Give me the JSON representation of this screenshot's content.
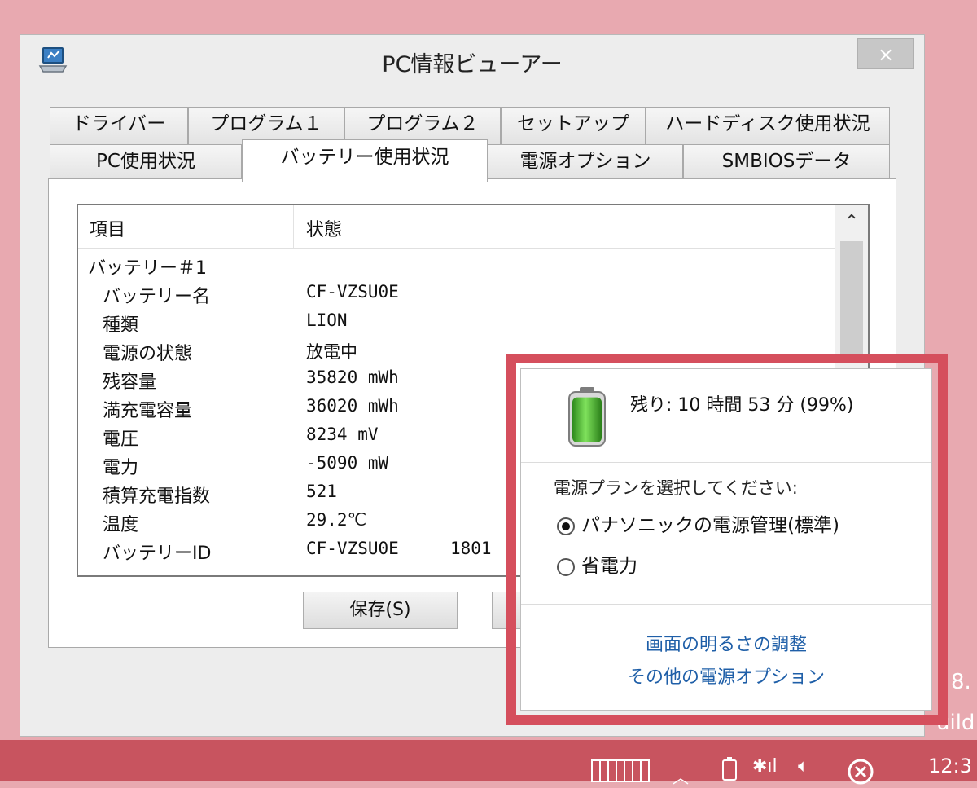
{
  "window": {
    "title": "PC情報ビューアー",
    "close_label": "×"
  },
  "tabs": {
    "row1": [
      {
        "label": "ドライバー"
      },
      {
        "label": "プログラム１"
      },
      {
        "label": "プログラム２"
      },
      {
        "label": "セットアップ"
      },
      {
        "label": "ハードディスク使用状況"
      }
    ],
    "row2": [
      {
        "label": "PC使用状況"
      },
      {
        "label": "バッテリー使用状況",
        "active": true
      },
      {
        "label": "電源オプション"
      },
      {
        "label": "SMBIOSデータ"
      }
    ]
  },
  "list": {
    "columns": [
      "項目",
      "状態"
    ],
    "rows": [
      {
        "item": "バッテリー＃1",
        "value": ""
      },
      {
        "item": "バッテリー名",
        "value": "CF-VZSU0E"
      },
      {
        "item": "種類",
        "value": "LION"
      },
      {
        "item": "電源の状態",
        "value": "放電中"
      },
      {
        "item": "残容量",
        "value": "35820 mWh"
      },
      {
        "item": "満充電容量",
        "value": "36020 mWh"
      },
      {
        "item": "電圧",
        "value": "8234 mV"
      },
      {
        "item": "電力",
        "value": "-5090 mW"
      },
      {
        "item": "積算充電指数",
        "value": "521"
      },
      {
        "item": "温度",
        "value": "29.2℃"
      },
      {
        "item": "バッテリーID",
        "value": "CF-VZSU0E     1801"
      }
    ]
  },
  "buttons": {
    "save": "保存(S)"
  },
  "flyout": {
    "remaining": "残り: 10 時間 53 分 (99%)",
    "plan_prompt": "電源プランを選択してください:",
    "plans": [
      {
        "label": "パナソニックの電源管理(標準)",
        "selected": true
      },
      {
        "label": "省電力",
        "selected": false
      }
    ],
    "links": [
      "画面の明るさの調整",
      "その他の電源オプション"
    ],
    "battery_level": 0.99,
    "highlight_color": "#d54f5d"
  },
  "desktop": {
    "text1": "8.",
    "text2": "uild"
  },
  "taskbar": {
    "clock": "12:3",
    "color": "#c8545f"
  }
}
